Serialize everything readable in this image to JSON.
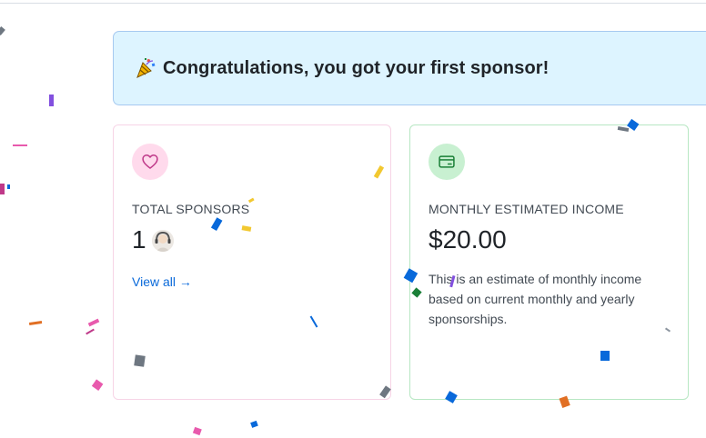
{
  "banner": {
    "icon": "party-popper-icon",
    "text": "Congratulations, you got your first sponsor!"
  },
  "sponsors_card": {
    "icon": "heart-icon",
    "label": "TOTAL SPONSORS",
    "value": "1",
    "avatar": "sponsor-avatar",
    "link_label": "View all →"
  },
  "income_card": {
    "icon": "credit-card-icon",
    "label": "MONTHLY ESTIMATED INCOME",
    "value": "$20.00",
    "description": "This is an estimate of monthly income based on current monthly and yearly sponsorships."
  },
  "colors": {
    "banner_bg": "#ddf4ff",
    "link": "#0969da",
    "pink_accent": "#bf3989",
    "green_accent": "#1a7f37"
  }
}
